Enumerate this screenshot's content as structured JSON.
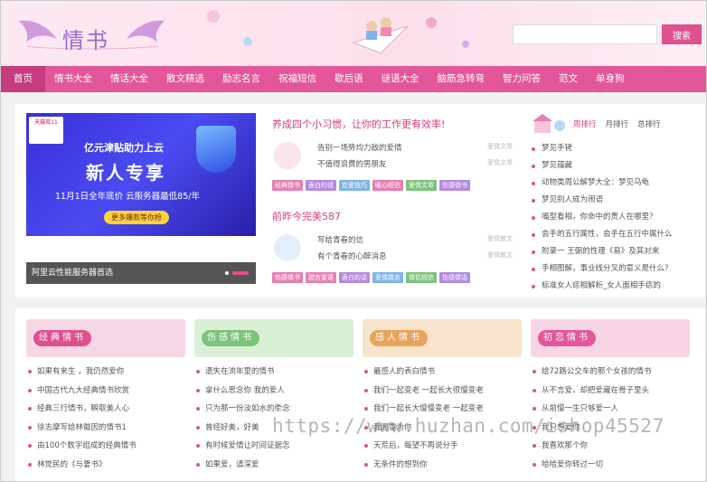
{
  "header": {
    "logo_text": "情书",
    "search_placeholder": "",
    "search_button": "搜索"
  },
  "nav": [
    "首页",
    "情书大全",
    "情话大全",
    "散文精选",
    "励志名言",
    "祝福短信",
    "歇后语",
    "谜语大全",
    "脑筋急转弯",
    "智力问答",
    "范文",
    "单身狗"
  ],
  "banner": {
    "badge": "天猫双11",
    "line1": "亿元津贴助力上云",
    "line2": "新人专享",
    "line3": "11月1日全年底价 云服务器最低85/年",
    "button": "更多爆款等你抢",
    "caption": "阿里云性能服务器首选"
  },
  "articles": [
    {
      "title": "养成四个小习惯，让你的工作更有效率!",
      "lines": [
        "告别一场势均力敌的爱情",
        "不值得浪费的男朋友"
      ],
      "line_tags": [
        "爱情文章",
        "爱情文章"
      ],
      "tags": [
        "经典情书",
        "表白的话",
        "恋爱技巧",
        "暖心短信",
        "爱情文章",
        "伤感情书"
      ],
      "thumb_color": "#fbe4ee"
    },
    {
      "title": "前昨今完美587",
      "lines": [
        "写给青春的信",
        "有个青春的心醉消息"
      ],
      "line_tags": [
        "爱情散文",
        "爱情散文"
      ],
      "tags": [
        "伤感情书",
        "甜言蜜语",
        "表白的话",
        "爱情箴言",
        "情侣短信",
        "伤感情话"
      ],
      "thumb_color": "#e3f0fb"
    }
  ],
  "rank": {
    "tabs": [
      "周排行",
      "月排行",
      "总排行"
    ],
    "active": 0,
    "items": [
      "梦见手铐",
      "梦见蕴藏",
      "动物类周公解梦大全：梦见乌龟",
      "梦见别人成为闹语",
      "嘴型看相，你命中的贵人在哪里？",
      "会手的五行属性，会手在五行中属什么",
      "附录一 王弼的性理《易》及其对来",
      "手相图解，事业线分叉的意义是什么？",
      "标准女人痣相解析_女人面相手痣的"
    ]
  },
  "categories": [
    {
      "title": "经典情书",
      "color": "#e0508f",
      "bg": "#f7d7e6",
      "items": [
        "如果有来生 ，我仍然爱你",
        "中国古代九大经典情书欣赏",
        "经典三行情书，瞬取美人心",
        "徐志摩写给林徽因的情书1",
        "由100个数字组成的经典情书",
        "林觉民的《与妻书》"
      ]
    },
    {
      "title": "伤感情书",
      "color": "#7cc47a",
      "bg": "#d9f0d6",
      "items": [
        "遗失在流年里的情书",
        "拿什么思念你 我的爱人",
        "只为那一份淡如水的牵念",
        "曾经好美，好美",
        "有时候爱情让时间证据怎",
        "如果爱，请深爱"
      ]
    },
    {
      "title": "感人情书",
      "color": "#e8a35a",
      "bg": "#f8e3cd",
      "items": [
        "最感人的表白情书",
        "我们一起变老 一起长大很慢变老",
        "我们一起长大慢慢变老 一起变老",
        "我愿意为你",
        "天荒后，每望不再说分手",
        "无条件的想到你"
      ]
    },
    {
      "title": "初恋情书",
      "color": "#e3579a",
      "bg": "#f8d5e5",
      "items": [
        "给72路公交车的那个女孩的情书",
        "从不言爱，却把爱藏在骨子里头",
        "从前慢一生只够爱一人",
        "我只想爱你",
        "我喜欢那个你",
        "哈哈爱你转过一切"
      ]
    }
  ],
  "watermark": "https://www.huzhan.com/ishop45527",
  "colors": {
    "brand_pink": "#e3579a",
    "nav_active": "#c73c7f",
    "title_pink": "#d63c7e"
  }
}
